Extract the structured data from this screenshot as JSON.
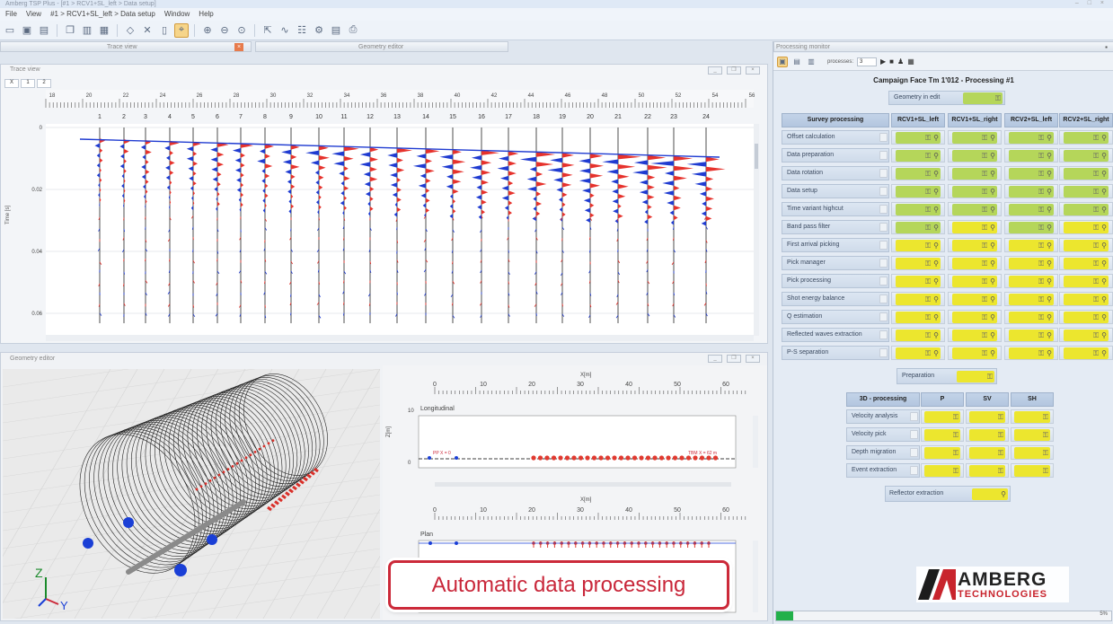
{
  "window": {
    "title": "Amberg TSP Plus - [#1 > RCV1+SL_left > Data setup]",
    "controls": "– □ ×"
  },
  "menu": {
    "items": [
      "File",
      "View",
      "#1 > RCV1+SL_left > Data setup",
      "Window",
      "Help"
    ]
  },
  "toolbar": {
    "icons": [
      "open-icon",
      "save-icon",
      "save-all-icon",
      "copy-icon",
      "layout-icon",
      "table-icon",
      "diamond-icon",
      "delete-icon",
      "select-icon",
      "zoom-in-icon",
      "zoom-out-icon",
      "zoom-fit-icon",
      "export-icon",
      "chart-icon",
      "data-icon",
      "settings-icon",
      "pdf-icon",
      "print-icon"
    ]
  },
  "tabs": {
    "trace": "Trace view",
    "geometry": "Geometry editor"
  },
  "trace": {
    "title": "Trace view",
    "subtabs": [
      "X",
      "1",
      "2"
    ],
    "ylabel": "Time [s]",
    "xticks": [
      "18",
      "20",
      "22",
      "24",
      "26",
      "28",
      "30",
      "32",
      "34",
      "36",
      "38",
      "40",
      "42",
      "44",
      "46",
      "48",
      "50",
      "52",
      "54",
      "56"
    ],
    "traces": [
      "1",
      "2",
      "3",
      "4",
      "5",
      "6",
      "7",
      "8",
      "9",
      "10",
      "11",
      "12",
      "13",
      "14",
      "15",
      "16",
      "17",
      "18",
      "19",
      "20",
      "21",
      "22",
      "23",
      "24"
    ],
    "yticks": [
      "0",
      "0.02",
      "0.04",
      "0.06"
    ]
  },
  "geometry": {
    "title": "Geometry editor",
    "axes": {
      "z": "Z",
      "y": "Y"
    },
    "top": {
      "xlabel": "X[m]",
      "ylabel": "Z[m]",
      "panel": "Longitudinal",
      "xticks": [
        "0",
        "10",
        "20",
        "30",
        "40",
        "50",
        "60"
      ],
      "yticks": [
        "10",
        "0"
      ],
      "left_tag": "PP X = 0",
      "right_tag": "TBM X = 62 m"
    },
    "bottom": {
      "xlabel": "X[m]",
      "panel": "Plan",
      "xticks": [
        "0",
        "10",
        "20",
        "30",
        "40",
        "50",
        "60"
      ]
    }
  },
  "processing": {
    "title": "Processing monitor",
    "processes_label": "processes:",
    "processes_value": "3",
    "campaign": "Campaign Face Tm 1'012 - Processing #1",
    "geometry_btn": "Geometry in edit",
    "survey_header": "Survey processing",
    "columns": [
      "RCV1+SL_left",
      "RCV1+SL_right",
      "RCV2+SL_left",
      "RCV2+SL_right"
    ],
    "rows": [
      "Offset calculation",
      "Data preparation",
      "Data rotation",
      "Data setup",
      "Time variant highcut",
      "Band pass filter",
      "First arrival picking",
      "Pick manager",
      "Pick processing",
      "Shot energy balance",
      "Q estimation",
      "Reflected waves extraction",
      "P-S separation"
    ],
    "status": [
      [
        "g",
        "g",
        "g",
        "g"
      ],
      [
        "g",
        "g",
        "g",
        "g"
      ],
      [
        "g",
        "g",
        "g",
        "g"
      ],
      [
        "g",
        "g",
        "g",
        "g"
      ],
      [
        "g",
        "g",
        "g",
        "g"
      ],
      [
        "g",
        "y",
        "g",
        "y"
      ],
      [
        "y",
        "y",
        "y",
        "y"
      ],
      [
        "y",
        "y",
        "y",
        "y"
      ],
      [
        "y",
        "y",
        "y",
        "y"
      ],
      [
        "y",
        "y",
        "y",
        "y"
      ],
      [
        "y",
        "y",
        "y",
        "y"
      ],
      [
        "y",
        "y",
        "y",
        "y"
      ],
      [
        "y",
        "y",
        "y",
        "y"
      ]
    ],
    "preparation": "Preparation",
    "proc3d_header": "3D - processing",
    "proc3d_cols": [
      "P",
      "SV",
      "SH"
    ],
    "proc3d_rows": [
      "Velocity analysis",
      "Velocity pick",
      "Depth migration",
      "Event extraction"
    ],
    "reflector": "Reflector extraction",
    "progress_percent": 5,
    "progress_label": "5%"
  },
  "overlay": {
    "caption": "Automatic data processing"
  },
  "logo": {
    "line1": "AMBERG",
    "line2": "TECHNOLOGIES"
  },
  "colors": {
    "accent_red": "#cc2a3a",
    "trace_red": "#e6322c",
    "trace_blue": "#1f3bd1",
    "status_yellow": "#ece62e",
    "status_green": "#b5d65a"
  }
}
